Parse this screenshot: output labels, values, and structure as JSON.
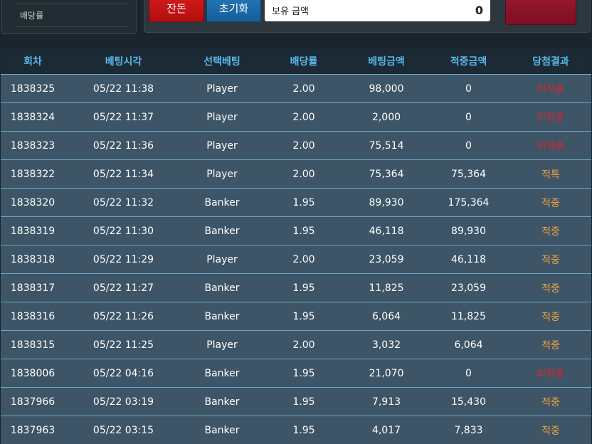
{
  "sidebar": {
    "label": "배당률"
  },
  "controls": {
    "cancel_label": "잔돈",
    "reset_label": "초기화",
    "balance_label": "보유 금액",
    "balance_value": "0"
  },
  "table": {
    "headers": [
      "회차",
      "베팅시각",
      "선택베팅",
      "배당률",
      "베팅금액",
      "적중금액",
      "당첨결과"
    ],
    "rows": [
      {
        "round": "1838325",
        "time": "05/22 11:38",
        "pick": "Player",
        "odds": "2.00",
        "bet": "98,000",
        "win": "0",
        "result": "미적중",
        "status": "miss"
      },
      {
        "round": "1838324",
        "time": "05/22 11:37",
        "pick": "Player",
        "odds": "2.00",
        "bet": "2,000",
        "win": "0",
        "result": "미적중",
        "status": "miss"
      },
      {
        "round": "1838323",
        "time": "05/22 11:36",
        "pick": "Player",
        "odds": "2.00",
        "bet": "75,514",
        "win": "0",
        "result": "미적중",
        "status": "miss"
      },
      {
        "round": "1838322",
        "time": "05/22 11:34",
        "pick": "Player",
        "odds": "2.00",
        "bet": "75,364",
        "win": "75,364",
        "result": "적특",
        "status": "hit"
      },
      {
        "round": "1838320",
        "time": "05/22 11:32",
        "pick": "Banker",
        "odds": "1.95",
        "bet": "89,930",
        "win": "175,364",
        "result": "적중",
        "status": "hit"
      },
      {
        "round": "1838319",
        "time": "05/22 11:30",
        "pick": "Banker",
        "odds": "1.95",
        "bet": "46,118",
        "win": "89,930",
        "result": "적중",
        "status": "hit"
      },
      {
        "round": "1838318",
        "time": "05/22 11:29",
        "pick": "Player",
        "odds": "2.00",
        "bet": "23,059",
        "win": "46,118",
        "result": "적중",
        "status": "hit"
      },
      {
        "round": "1838317",
        "time": "05/22 11:27",
        "pick": "Banker",
        "odds": "1.95",
        "bet": "11,825",
        "win": "23,059",
        "result": "적중",
        "status": "hit"
      },
      {
        "round": "1838316",
        "time": "05/22 11:26",
        "pick": "Banker",
        "odds": "1.95",
        "bet": "6,064",
        "win": "11,825",
        "result": "적중",
        "status": "hit"
      },
      {
        "round": "1838315",
        "time": "05/22 11:25",
        "pick": "Player",
        "odds": "2.00",
        "bet": "3,032",
        "win": "6,064",
        "result": "적중",
        "status": "hit"
      },
      {
        "round": "1838006",
        "time": "05/22 04:16",
        "pick": "Banker",
        "odds": "1.95",
        "bet": "21,070",
        "win": "0",
        "result": "미적중",
        "status": "miss"
      },
      {
        "round": "1837966",
        "time": "05/22 03:19",
        "pick": "Banker",
        "odds": "1.95",
        "bet": "7,913",
        "win": "15,430",
        "result": "적중",
        "status": "hit"
      },
      {
        "round": "1837963",
        "time": "05/22 03:15",
        "pick": "Banker",
        "odds": "1.95",
        "bet": "4,017",
        "win": "7,833",
        "result": "적중",
        "status": "hit"
      }
    ]
  },
  "colors": {
    "header_text": "#5ab8ea",
    "hit": "#f2a33c",
    "miss": "#e0212e",
    "row_bg": "#3d5566"
  }
}
